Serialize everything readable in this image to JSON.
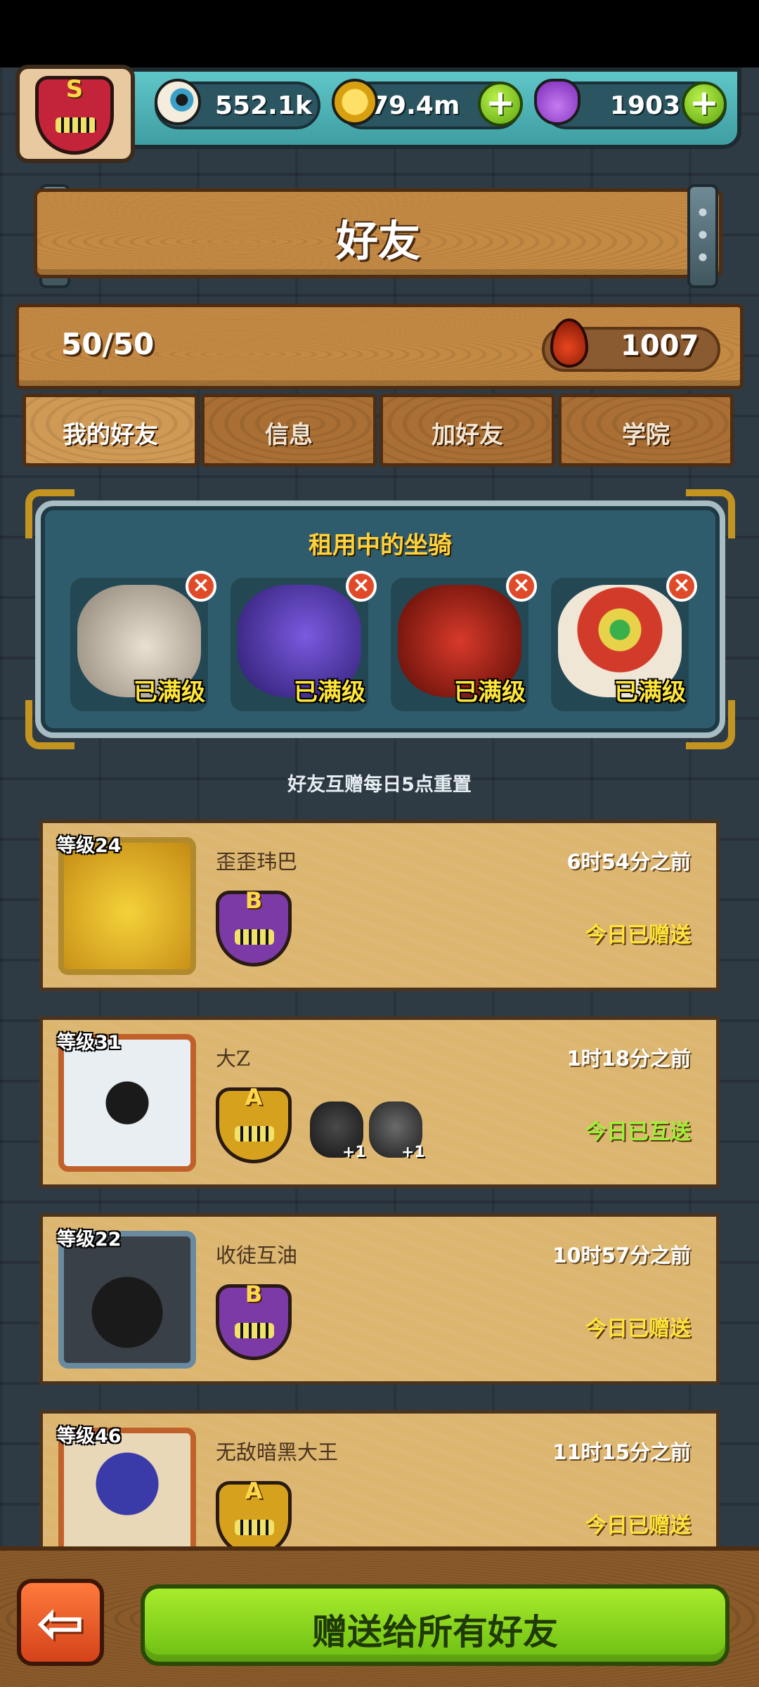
{
  "header": {
    "rank_letter": "S",
    "resources": [
      {
        "icon": "eyeball-icon",
        "value": "552.1k"
      },
      {
        "icon": "gold-coin-icon",
        "value": "79.4m"
      },
      {
        "icon": "potion-icon",
        "value": "1903"
      }
    ]
  },
  "page_title": "好友",
  "summary": {
    "friend_count": "50/50",
    "blood_value": "1007"
  },
  "tabs": [
    {
      "label": "我的好友",
      "active": true
    },
    {
      "label": "信息",
      "active": false
    },
    {
      "label": "加好友",
      "active": false
    },
    {
      "label": "学院",
      "active": false
    }
  ],
  "rented_mounts": {
    "title": "租用中的坐骑",
    "items": [
      {
        "label": "已满级",
        "icon": "white-beast-mount-icon",
        "color": "#d9d2c4"
      },
      {
        "label": "已满级",
        "icon": "purple-rose-mount-icon",
        "color": "#5b3aa8"
      },
      {
        "label": "已满级",
        "icon": "red-demon-mount-icon",
        "color": "#a8261c"
      },
      {
        "label": "已满级",
        "icon": "lion-dance-mount-icon",
        "color": "#c43a2a"
      }
    ]
  },
  "reset_note": "好友互赠每日5点重置",
  "friends": [
    {
      "level": "等级24",
      "name": "歪歪玮巴",
      "time": "6时54分之前",
      "status": "今日已赠送",
      "rank": "B",
      "status_color": "yellow",
      "extras": []
    },
    {
      "level": "等级31",
      "name": "大Z",
      "time": "1时18分之前",
      "status": "今日已互送",
      "rank": "A",
      "status_color": "green",
      "extras": [
        "+1",
        "+1"
      ]
    },
    {
      "level": "等级22",
      "name": "收徒互油",
      "time": "10时57分之前",
      "status": "今日已赠送",
      "rank": "B",
      "status_color": "yellow",
      "extras": []
    },
    {
      "level": "等级46",
      "name": "无敌暗黑大王",
      "time": "11时15分之前",
      "status": "今日已赠送",
      "rank": "A",
      "status_color": "yellow",
      "extras": []
    }
  ],
  "footer": {
    "gift_all_label": "赠送给所有好友"
  },
  "colors": {
    "accent_green": "#8ad61e",
    "status_yellow": "#ffe33a",
    "status_green": "#9ef03a",
    "rank_b": "#7b3aa6",
    "rank_a": "#d6a21e"
  }
}
